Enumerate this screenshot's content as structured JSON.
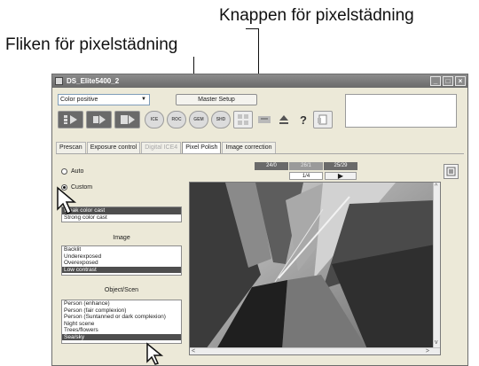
{
  "callouts": {
    "pixel_polish_button": "Knappen för pixelstädning",
    "pixel_polish_tab": "Fliken för pixelstädning"
  },
  "window": {
    "title": "DS_Elite5400_2",
    "film_type": "Color positive",
    "master_setup": "Master Setup",
    "toolbar_icons": [
      "index-scan-icon",
      "prescan-icon",
      "scan-icon",
      "ice-icon",
      "roc-icon",
      "gem-icon",
      "sharpness-icon",
      "pixel-polish-icon",
      "save-icon",
      "eject-icon",
      "help-icon",
      "preferences-icon"
    ],
    "help_label": "?"
  },
  "tabs": [
    {
      "label": "Prescan",
      "state": "normal"
    },
    {
      "label": "Exposure control",
      "state": "normal"
    },
    {
      "label": "Digital ICE4",
      "state": "disabled"
    },
    {
      "label": "Pixel Polish",
      "state": "active"
    },
    {
      "label": "Image correction",
      "state": "normal"
    }
  ],
  "left": {
    "auto_label": "Auto",
    "custom_label": "Custom",
    "cast_list": [
      "Weak color cast",
      "Strong color cast"
    ],
    "cast_selected": 0,
    "image_label": "Image",
    "image_list": [
      "Backlit",
      "Underexposed",
      "Overexposed",
      "Low contrast"
    ],
    "image_selected": 3,
    "object_label": "Object/Scen",
    "object_list": [
      "Person (enhance)",
      "Person (fair complexion)",
      "Person (Suntanned or dark complexion)",
      "Night scene",
      "Trees/flowers",
      "Sea/sky"
    ],
    "object_selected": 5
  },
  "preview": {
    "frames": [
      "24/0",
      "26/1",
      "25/29"
    ],
    "counter": "1/4",
    "play_glyph": "▶"
  }
}
